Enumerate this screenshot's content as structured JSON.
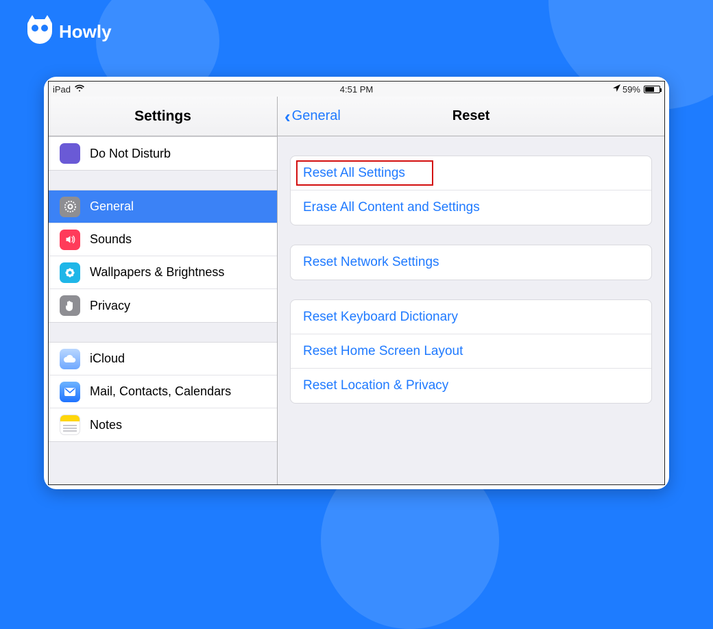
{
  "brand": {
    "name": "Howly"
  },
  "status": {
    "device": "iPad",
    "time": "4:51 PM",
    "battery_text": "59%"
  },
  "sidebar": {
    "title": "Settings",
    "items": {
      "dnd": "Do Not Disturb",
      "general": "General",
      "sounds": "Sounds",
      "wallpapers": "Wallpapers & Brightness",
      "privacy": "Privacy",
      "icloud": "iCloud",
      "mail": "Mail, Contacts, Calendars",
      "notes": "Notes"
    }
  },
  "detail": {
    "back_label": "General",
    "title": "Reset",
    "group1": {
      "reset_all": "Reset All Settings",
      "erase_all": "Erase All Content and Settings"
    },
    "group2": {
      "reset_network": "Reset Network Settings"
    },
    "group3": {
      "reset_keyboard": "Reset Keyboard Dictionary",
      "reset_home": "Reset Home Screen Layout",
      "reset_location": "Reset Location & Privacy"
    }
  }
}
